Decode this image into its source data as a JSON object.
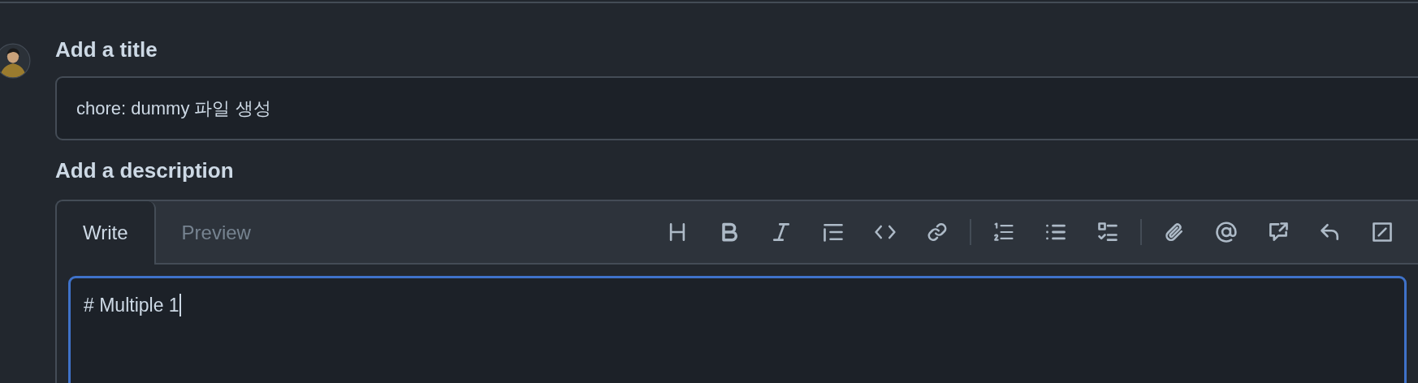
{
  "title_section": {
    "label": "Add a title",
    "value": "chore: dummy 파일 생성"
  },
  "description_section": {
    "label": "Add a description",
    "tabs": [
      {
        "label": "Write",
        "selected": true
      },
      {
        "label": "Preview",
        "selected": false
      }
    ],
    "body": "# Multiple 1"
  }
}
